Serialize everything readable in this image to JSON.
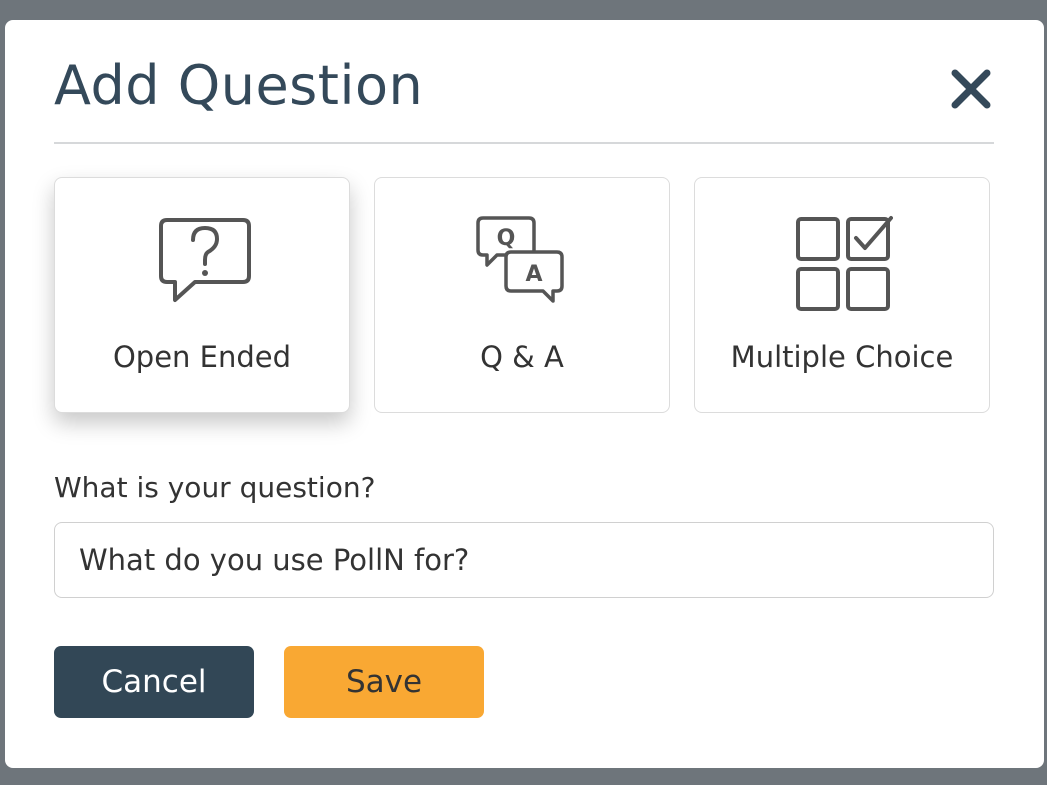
{
  "modal": {
    "title": "Add Question",
    "close_icon": "close-icon"
  },
  "question_types": [
    {
      "label": "Open Ended",
      "icon": "question-bubble-icon",
      "selected": true
    },
    {
      "label": "Q & A",
      "icon": "qa-bubbles-icon",
      "selected": false
    },
    {
      "label": "Multiple Choice",
      "icon": "checkbox-grid-icon",
      "selected": false
    }
  ],
  "question_field": {
    "label": "What is your question?",
    "value": "What do you use PollN for?"
  },
  "actions": {
    "cancel_label": "Cancel",
    "save_label": "Save"
  },
  "colors": {
    "primary_dark": "#324756",
    "accent": "#f9a833",
    "backdrop": "#6e757b"
  }
}
